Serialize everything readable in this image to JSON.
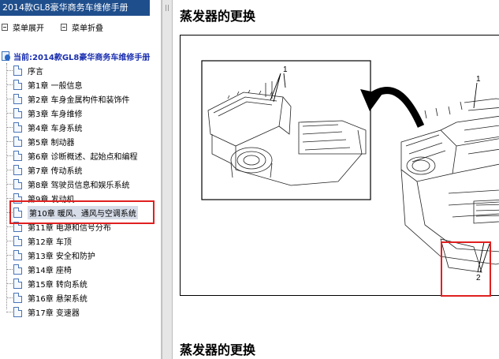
{
  "app": {
    "title": "2014款GL8豪华商务车维修手册"
  },
  "toolbar": {
    "expand_label": "菜单展开",
    "collapse_label": "菜单折叠"
  },
  "tree": {
    "root_label": "当前:2014款GL8豪华商务车维修手册",
    "items": [
      {
        "label": "序言"
      },
      {
        "label": "第1章 一般信息"
      },
      {
        "label": "第2章 车身金属构件和装饰件"
      },
      {
        "label": "第3章 车身维修"
      },
      {
        "label": "第4章 车身系统"
      },
      {
        "label": "第5章 制动器"
      },
      {
        "label": "第6章 诊断概述、起始点和编程"
      },
      {
        "label": "第7章 传动系统"
      },
      {
        "label": "第8章 驾驶员信息和娱乐系统"
      },
      {
        "label": "第9章 发动机"
      },
      {
        "label": "第10章 暖风、通风与空调系统"
      },
      {
        "label": "第11章 电源和信号分布"
      },
      {
        "label": "第12章 车顶"
      },
      {
        "label": "第13章 安全和防护"
      },
      {
        "label": "第14章 座椅"
      },
      {
        "label": "第15章 转向系统"
      },
      {
        "label": "第16章 悬架系统"
      },
      {
        "label": "第17章 变速器"
      }
    ],
    "selected_index": 10
  },
  "content": {
    "heading_top": "蒸发器的更换",
    "heading_bottom": "蒸发器的更换",
    "callouts": {
      "inset_1": "1",
      "main_1": "1",
      "main_2": "2"
    }
  },
  "colors": {
    "title_bar": "#1f4e8c",
    "highlight_box": "#e02020",
    "root_text": "#1a2fb0"
  }
}
